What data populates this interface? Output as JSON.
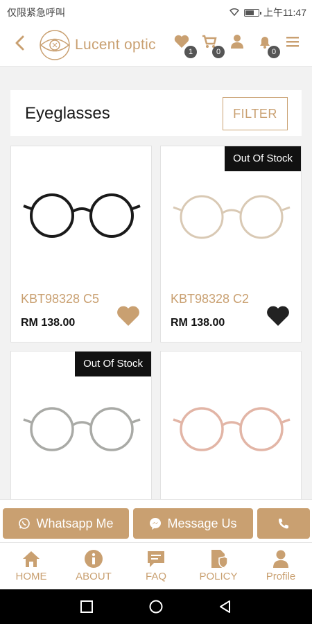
{
  "status_bar": {
    "carrier_text": "仅限紧急呼叫",
    "time": "上午11:47"
  },
  "header": {
    "brand": "Lucent optic",
    "wishlist_count": "1",
    "cart_count": "0",
    "notification_count": "0"
  },
  "page": {
    "title": "Eyeglasses",
    "filter_label": "FILTER"
  },
  "products": [
    {
      "name": "KBT98328 C5",
      "price": "RM 138.00",
      "out_of_stock": "",
      "favorited": true,
      "frame_color": "#1a1a1a"
    },
    {
      "name": "KBT98328 C2",
      "price": "RM 138.00",
      "out_of_stock": "Out Of Stock",
      "favorited": true,
      "frame_color": "#d9c9b4"
    },
    {
      "name": "",
      "price": "",
      "out_of_stock": "Out Of Stock",
      "favorited": false,
      "frame_color": "#a9aaa6"
    },
    {
      "name": "",
      "price": "",
      "out_of_stock": "",
      "favorited": false,
      "frame_color": "#e2b5a6"
    }
  ],
  "contact": {
    "whatsapp_label": "Whatsapp Me",
    "messenger_label": "Message Us"
  },
  "bottom_nav": {
    "home": "HOME",
    "about": "ABOUT",
    "faq": "FAQ",
    "policy": "POLICY",
    "profile": "Profile"
  },
  "colors": {
    "accent": "#c9a071",
    "dark": "#111111"
  }
}
